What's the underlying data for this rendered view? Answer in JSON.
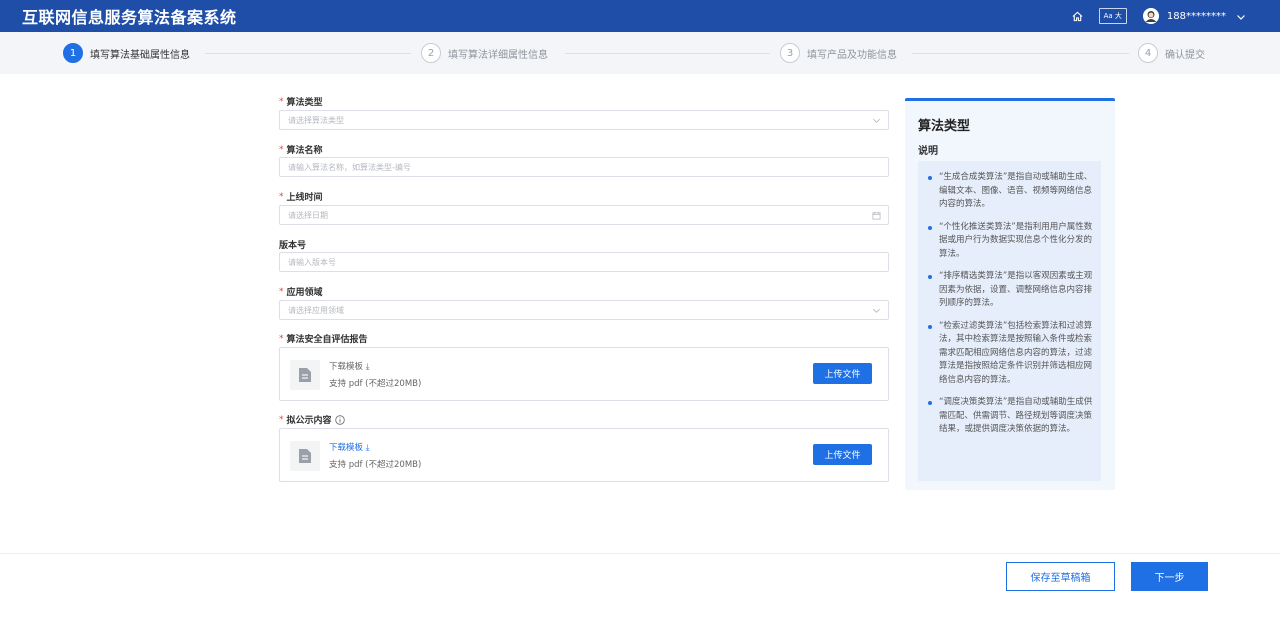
{
  "header": {
    "app_title": "互联网信息服务算法备案系统",
    "font_size_label": "Aa 大",
    "user_name": "188********",
    "icons": [
      "home-icon",
      "avatar",
      "chevron-down-icon"
    ]
  },
  "steps": [
    {
      "num": "1",
      "label": "填写算法基础属性信息",
      "active": true
    },
    {
      "num": "2",
      "label": "填写算法详细属性信息",
      "active": false
    },
    {
      "num": "3",
      "label": "填写产品及功能信息",
      "active": false
    },
    {
      "num": "4",
      "label": "确认提交",
      "active": false
    }
  ],
  "form": {
    "algo_type": {
      "label": "算法类型",
      "required": "*",
      "placeholder": "请选择算法类型"
    },
    "algo_name": {
      "label": "算法名称",
      "required": "*",
      "placeholder": "请输入算法名称，如算法类型-编号"
    },
    "online_time": {
      "label": "上线时间",
      "required": "*",
      "placeholder": "请选择日期"
    },
    "version": {
      "label": "版本号",
      "placeholder": "请输入版本号"
    },
    "domain": {
      "label": "应用领域",
      "required": "*",
      "placeholder": "请选择应用领域"
    },
    "report": {
      "label": "算法安全自评估报告",
      "required": "*",
      "download": "下载模板",
      "hint": "支持 pdf (不超过20MB)",
      "upload": "上传文件"
    },
    "public": {
      "label": "拟公示内容",
      "required": "*",
      "download": "下载模板",
      "hint": "支持 pdf (不超过20MB)",
      "upload": "上传文件"
    }
  },
  "panel": {
    "title": "算法类型",
    "subtitle": "说明",
    "items": [
      "“生成合成类算法”是指自动或辅助生成、编辑文本、图像、语音、视频等网络信息内容的算法。",
      "“个性化推送类算法”是指利用用户属性数据或用户行为数据实现信息个性化分发的算法。",
      "“排序精选类算法”是指以客观因素或主观因素为依据，设置、调整网络信息内容排列顺序的算法。",
      "“检索过滤类算法”包括检索算法和过滤算法，其中检索算法是按照输入条件或检索需求匹配相应网络信息内容的算法，过滤算法是指按照给定条件识别并筛选相应网络信息内容的算法。",
      "“调度决策类算法”是指自动或辅助生成供需匹配、供需调节、路径规划等调度决策结果，或提供调度决策依据的算法。"
    ]
  },
  "footer": {
    "save_draft": "保存至草稿箱",
    "next": "下一步"
  },
  "colors": {
    "primary": "#1f6fe5",
    "header": "#1e4ea8",
    "required": "#e0483a"
  }
}
